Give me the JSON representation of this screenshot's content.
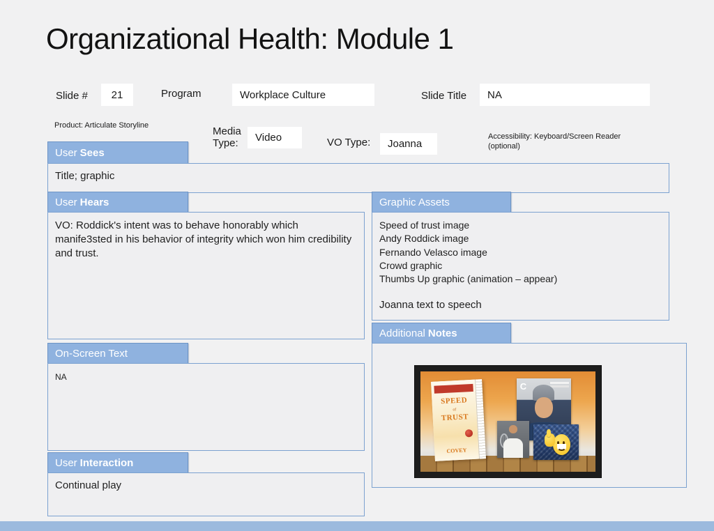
{
  "page": {
    "title": "Organizational Health: Module 1"
  },
  "meta": {
    "slide_number": {
      "label": "Slide #",
      "value": "21"
    },
    "program": {
      "label": "Program",
      "value": "Workplace Culture"
    },
    "slide_title": {
      "label": "Slide Title",
      "value": "NA"
    },
    "product": "Product: Articulate Storyline",
    "media_type": {
      "label": "Media Type:",
      "value": "Video"
    },
    "vo_type": {
      "label": "VO Type:",
      "value": "Joanna"
    },
    "accessibility": "Accessibility: Keyboard/Screen Reader (optional)"
  },
  "sections": {
    "user_sees": {
      "label_regular": "User",
      "label_bold": "Sees",
      "content": "Title; graphic"
    },
    "user_hears": {
      "label_regular": "User",
      "label_bold": "Hears",
      "content": "VO: Roddick's intent was to behave honorably which manife3sted in his behavior of integrity which won him credibility and trust."
    },
    "graphic_assets": {
      "label_regular": "Graphic Assets",
      "label_bold": "",
      "items": [
        "Speed of trust image",
        "Andy Roddick image",
        "Fernando Velasco image",
        "Crowd graphic",
        "Thumbs Up graphic (animation – appear)"
      ],
      "footer": "Joanna text to speech"
    },
    "on_screen_text": {
      "label_regular": "On-Screen Text",
      "label_bold": "",
      "content": "NA"
    },
    "additional_notes": {
      "label_regular": "Additional",
      "label_bold": "Notes"
    },
    "user_interaction": {
      "label_regular": "User",
      "label_bold": "Interaction",
      "content": "Continual play"
    }
  },
  "thumbnail": {
    "book_line1": "SPEED",
    "book_line2": "of",
    "book_line3": "TRUST",
    "book_author": "COVEY",
    "roddick_logo": "C"
  },
  "colors": {
    "section_bar": "#8fb2df",
    "box_border": "#7ba1d0",
    "page_background": "#f1f1f2",
    "bottom_bar": "#9cbade",
    "thumb_background_orange": "#e9953f"
  }
}
